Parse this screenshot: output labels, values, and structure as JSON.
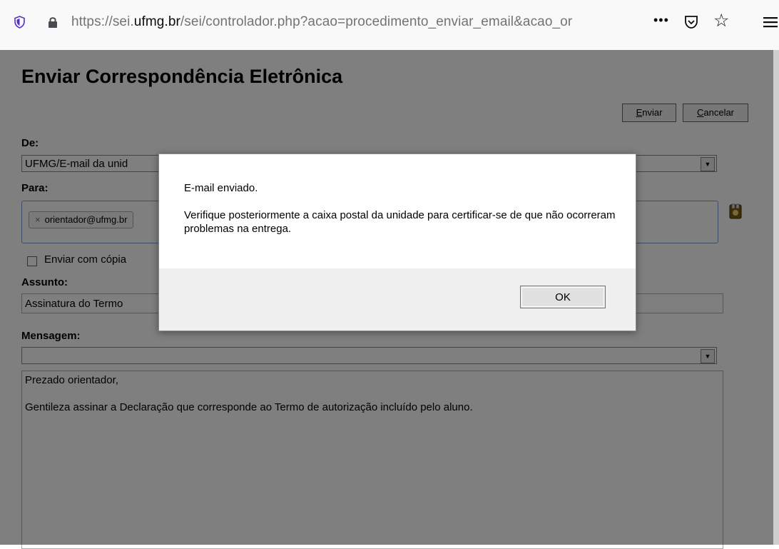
{
  "browser": {
    "url_prefix": "https://sei.",
    "url_domain": "ufmg.br",
    "url_rest": "/sei/controlador.php?acao=procedimento_enviar_email&acao_or",
    "more_label": "•••",
    "star_label": "☆"
  },
  "page": {
    "title": "Enviar Correspondência Eletrônica",
    "enviar_first": "E",
    "enviar_rest": "nviar",
    "cancelar_first": "C",
    "cancelar_rest": "ancelar",
    "de_label": "De:",
    "de_value": "UFMG/E-mail da unid",
    "para_label": "Para:",
    "para_tag": "orientador@ufmg.br",
    "para_tag_remove": "×",
    "cc_label": "Enviar com cópia",
    "assunto_label": "Assunto:",
    "assunto_value": "Assinatura do Termo",
    "mensagem_label": "Mensagem:",
    "mensagem_select_value": "",
    "message_line1": "Prezado orientador,",
    "message_line2": "Gentileza assinar a Declaração que corresponde ao Termo de autorização incluído pelo aluno."
  },
  "dialog": {
    "line1": "E-mail enviado.",
    "line2": "Verifique posteriormente a caixa postal da unidade para certificar-se de que não ocorreram problemas na entrega.",
    "ok_label": "OK"
  }
}
